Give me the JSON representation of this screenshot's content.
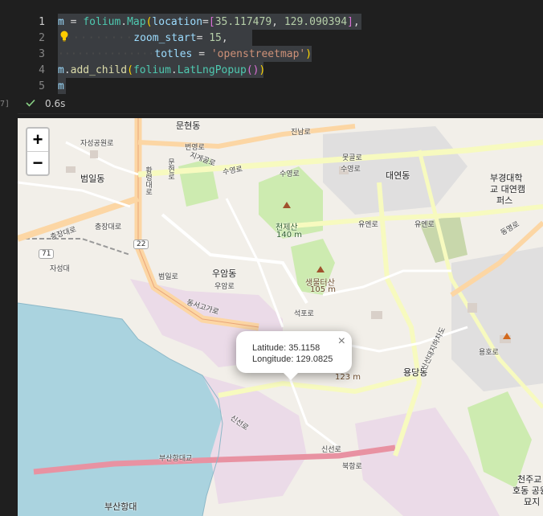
{
  "editor": {
    "line_numbers": [
      "1",
      "2",
      "3",
      "4",
      "5"
    ],
    "code": {
      "l1_m": "m",
      "l1_eq": " = ",
      "l1_folium": "folium",
      "l1_dot": ".",
      "l1_map": "Map",
      "l1_paren": "(",
      "l1_location": "location",
      "l1_eq2": "=",
      "l1_bracket_open": "[",
      "l1_lat": "35.117479",
      "l1_comma": ", ",
      "l1_lon": "129.090394",
      "l1_bracket_close": "]",
      "l1_trail": ",",
      "l2_dots": "··········",
      "l2_kw": "zoom_start",
      "l2_eq": "= ",
      "l2_val": "15",
      "l2_trail": ",",
      "l3_dots": "···············",
      "l3_kw": "totles",
      "l3_eq": " = ",
      "l3_val": "'openstreetmap'",
      "l3_close": ")",
      "l4_m": "m",
      "l4_dot": ".",
      "l4_fn": "add_child",
      "l4_paren_open": "(",
      "l4_folium": "folium",
      "l4_dot2": ".",
      "l4_cls": "LatLngPopup",
      "l4_call": "()",
      "l4_paren_close": ")",
      "l5_m": "m"
    }
  },
  "status": {
    "cell_marker": "7]",
    "exec_time": "0.6s"
  },
  "map": {
    "zoom_in": "+",
    "zoom_out": "−",
    "popup": {
      "close": "×",
      "latitude": "Latitude: 35.1158",
      "longitude": "Longitude: 129.0825"
    },
    "labels": {
      "munhyeon": "문현동",
      "beomil": "범일동",
      "jaseong": "자성대",
      "jaseong_park": "자성공원로",
      "chungjang": "충장대로",
      "beomil_ro": "범일로",
      "uam": "우암동",
      "uam_ro": "우암로",
      "daeyeon": "대연동",
      "cheonjesan": "천제산",
      "cheonjesan_h": "140 m",
      "saengmoksan": "생물터산",
      "saengmoksan_h": "105 m",
      "height123": "123 m",
      "yongdang": "용당동",
      "suyeong_ro1": "수영로",
      "suyeong_ro2": "수영로",
      "suyeong_ro3": "수영로",
      "jingnam_ro": "진남로",
      "mokgol_ro": "못골로",
      "yuyeon_ro1": "유엔로",
      "yuyeon_ro2": "유엔로",
      "dongseo": "동서고가로",
      "seokpo": "석포로",
      "sinseon_ro": "신선로",
      "sinseon_ro2": "신선로",
      "bukhang": "북항로",
      "busanhang": "부산항대교",
      "busanhang2": "부산항대",
      "pukyong": "부경대학",
      "pukyong2": "교 대연캠",
      "pukyong3": "퍼스",
      "yongho": "용호로",
      "dongmyeong": "동명로",
      "sinseon_daero": "신선대지하차도",
      "cheonju": "천주교",
      "hodong": "호동 공원",
      "myoji": "묘지",
      "chungjang2": "충장대로",
      "munhyeon_ro": "문현로",
      "jigye": "지게골로",
      "beonyeong": "번영로",
      "hwanggyeong": "황령대로",
      "route22": "22",
      "route71": "71"
    }
  }
}
